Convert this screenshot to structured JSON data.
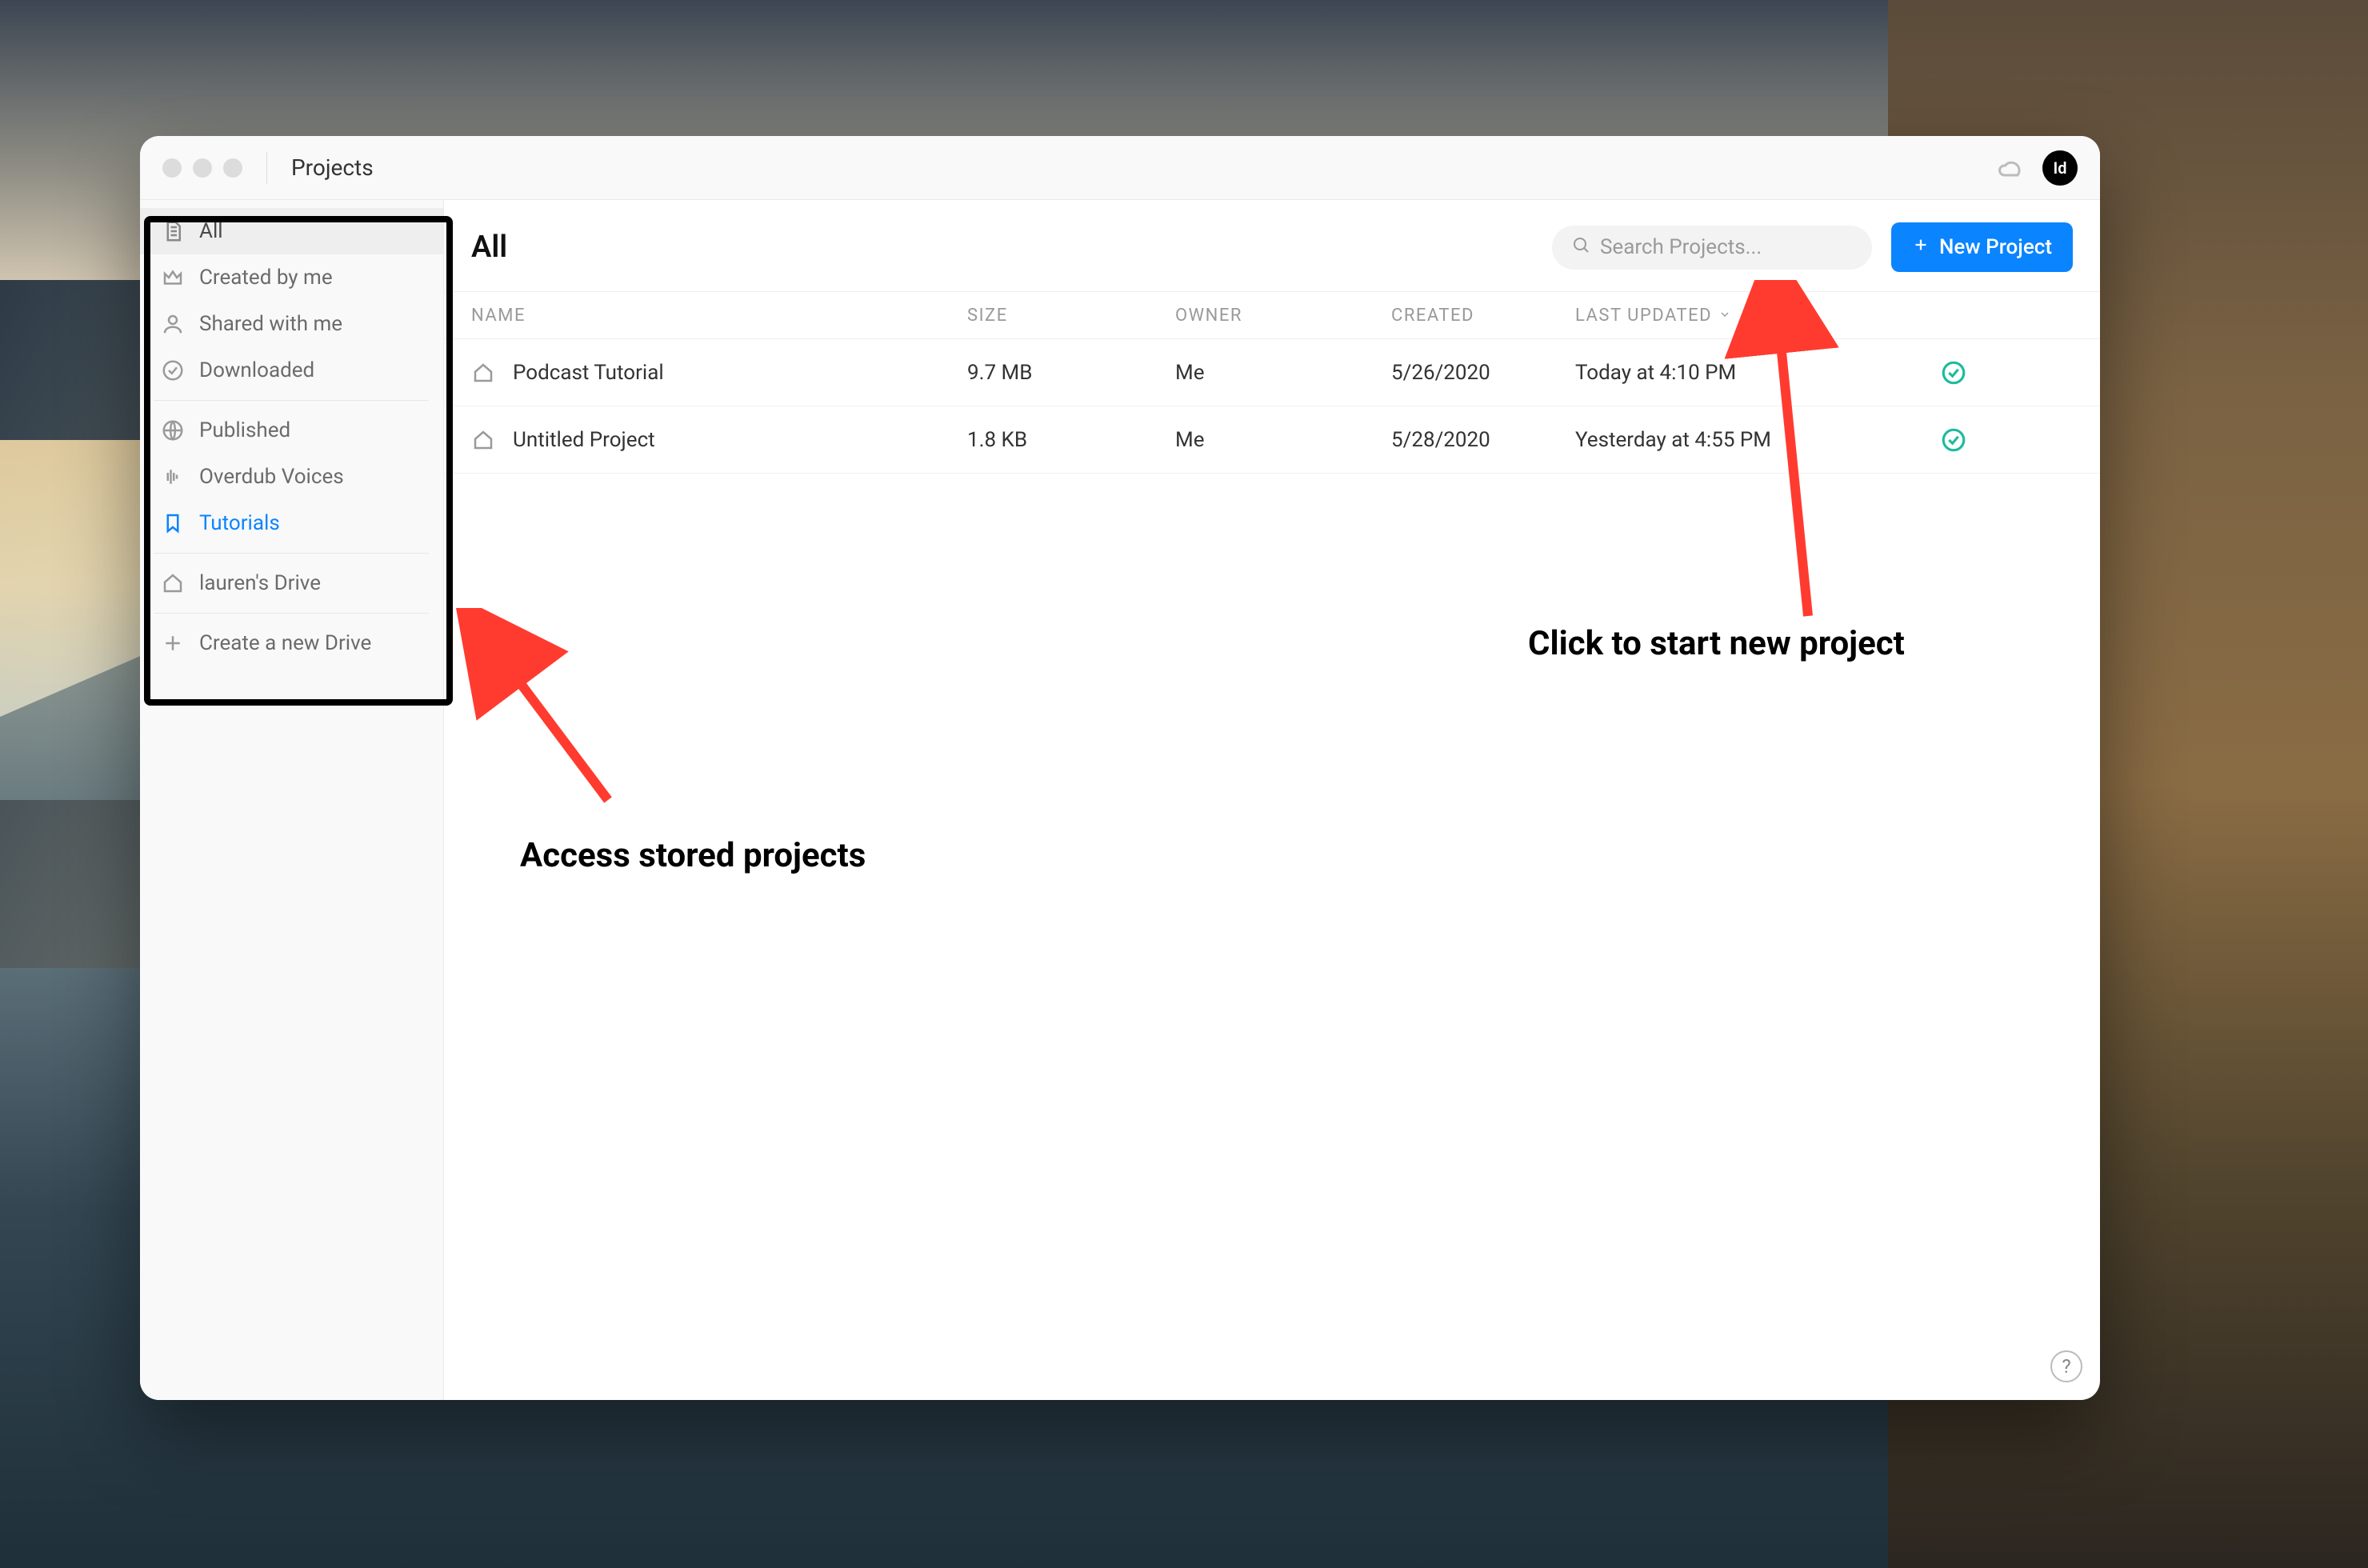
{
  "window": {
    "title": "Projects",
    "avatar_initials": "Id"
  },
  "sidebar": {
    "items1": [
      {
        "label": "All"
      },
      {
        "label": "Created by me"
      },
      {
        "label": "Shared with me"
      },
      {
        "label": "Downloaded"
      }
    ],
    "items2": [
      {
        "label": "Published"
      },
      {
        "label": "Overdub Voices"
      },
      {
        "label": "Tutorials"
      }
    ],
    "drive": {
      "label": "lauren's Drive"
    },
    "create_drive": {
      "label": "Create a new Drive"
    }
  },
  "main": {
    "heading": "All",
    "search_placeholder": "Search Projects...",
    "new_project_label": "New Project",
    "columns": {
      "name": "NAME",
      "size": "SIZE",
      "owner": "OWNER",
      "created": "CREATED",
      "updated": "LAST UPDATED"
    },
    "rows": [
      {
        "name": "Podcast Tutorial",
        "size": "9.7 MB",
        "owner": "Me",
        "created": "5/26/2020",
        "updated": "Today at 4:10 PM"
      },
      {
        "name": "Untitled Project",
        "size": "1.8 KB",
        "owner": "Me",
        "created": "5/28/2020",
        "updated": "Yesterday at 4:55 PM"
      }
    ]
  },
  "annotations": {
    "new_project": "Click to start new project",
    "access_stored": "Access stored projects"
  }
}
